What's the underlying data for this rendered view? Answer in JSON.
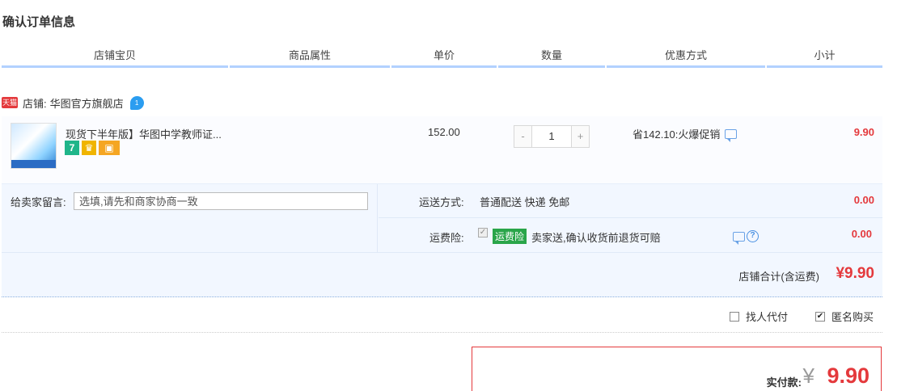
{
  "page_title": "确认订单信息",
  "columns": [
    "店铺宝贝",
    "商品属性",
    "单价",
    "数量",
    "优惠方式",
    "小计"
  ],
  "shop": {
    "badge": "天猫",
    "label": "店铺:",
    "name": "华图官方旗舰店",
    "wangwang_icon": "wangwang-chat-icon"
  },
  "item": {
    "title": "现货下半年版】华图中学教师证...",
    "icons": [
      "7-day-return-icon",
      "gift-icon",
      "card-icon"
    ],
    "unit_price": "152.00",
    "quantity": "1",
    "qty_minus": "-",
    "qty_plus": "+",
    "promo": "省142.10:火爆促销",
    "subtotal": "9.90"
  },
  "message": {
    "label": "给卖家留言:",
    "placeholder": "选填,请先和商家协商一致"
  },
  "shipping": {
    "label": "运送方式:",
    "value": "普通配送 快递 免邮",
    "amount": "0.00"
  },
  "insurance": {
    "label": "运费险:",
    "badge": "运费险",
    "text": "卖家送,确认收货前退货可赔",
    "amount": "0.00"
  },
  "shop_total": {
    "label": "店铺合计(含运费)",
    "value": "¥9.90"
  },
  "options": {
    "daifu": "找人代付",
    "niming": "匿名购买",
    "niming_checked": true
  },
  "payment": {
    "label": "实付款:",
    "yen": "¥",
    "amount": "9.90"
  },
  "colors": {
    "accent_red": "#e4393c",
    "header_underline": "#b2d1ff",
    "panel_bg": "#f2f7ff"
  }
}
